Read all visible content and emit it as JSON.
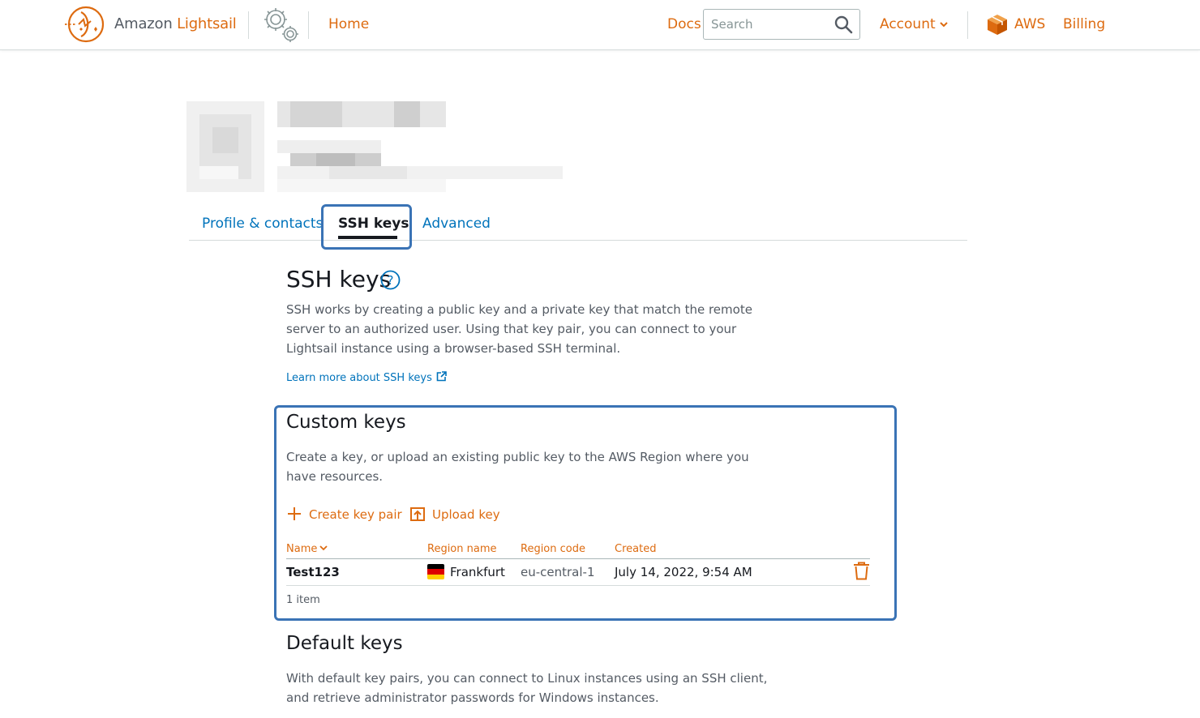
{
  "nav": {
    "brand_prefix": "Amazon ",
    "brand_highlight": "Lightsail",
    "home": "Home",
    "docs": "Docs",
    "search_placeholder": "Search",
    "account": "Account",
    "aws": "AWS",
    "billing": "Billing"
  },
  "tabs": [
    {
      "label": "Profile & contacts",
      "active": false
    },
    {
      "label": "SSH keys",
      "active": true
    },
    {
      "label": "Advanced",
      "active": false
    }
  ],
  "ssh": {
    "title": "SSH keys",
    "help_glyph": "?",
    "description": "SSH works by creating a public key and a private key that match the remote server to an authorized user. Using that key pair, you can connect to your Lightsail instance using a browser-based SSH terminal.",
    "learn_more": "Learn more about SSH keys"
  },
  "custom_keys": {
    "title": "Custom keys",
    "description": "Create a key, or upload an existing public key to the AWS Region where you have resources.",
    "create_label": "Create key pair",
    "upload_label": "Upload key",
    "columns": {
      "name": "Name",
      "region_name": "Region name",
      "region_code": "Region code",
      "created": "Created"
    },
    "rows": [
      {
        "name": "Test123",
        "region_name": "Frankfurt",
        "region_code": "eu-central-1",
        "created": "July 14, 2022, 9:54 AM"
      }
    ],
    "count_label": "1 item"
  },
  "default_keys": {
    "title": "Default keys",
    "description": "With default key pairs, you can connect to Linux instances using an SSH client, and retrieve administrator passwords for Windows instances."
  },
  "colors": {
    "accent_orange": "#dd6b10",
    "link_blue": "#0073bb",
    "highlight_blue": "#3a73b5"
  }
}
